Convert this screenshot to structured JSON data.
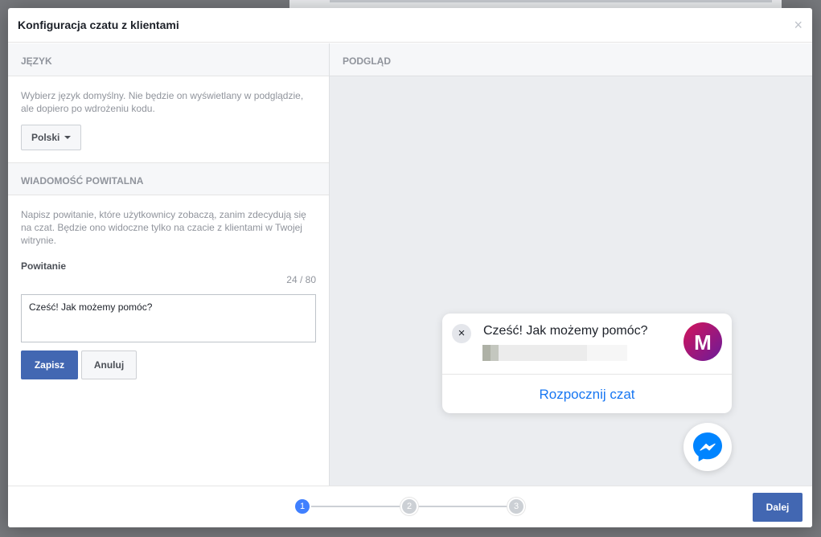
{
  "dialog": {
    "title": "Konfiguracja czatu z klientami",
    "close_glyph": "×"
  },
  "language_section": {
    "heading": "JĘZYK",
    "help": "Wybierz język domyślny. Nie będzie on wyświetlany w podglądzie, ale dopiero po wdrożeniu kodu.",
    "selected_language": "Polski"
  },
  "welcome_section": {
    "heading": "WIADOMOŚĆ POWITALNA",
    "help": "Napisz powitanie, które użytkownicy zobaczą, zanim zdecydują się na czat. Będzie ono widoczne tylko na czacie z klientami w Twojej witrynie.",
    "field_label": "Powitanie",
    "counter": "24 / 80",
    "greeting_value": "Cześć! Jak możemy pomóc?",
    "save_label": "Zapisz",
    "cancel_label": "Anuluj"
  },
  "preview": {
    "heading": "PODGLĄD",
    "greeting": "Cześć! Jak możemy pomóc?",
    "start_chat_label": "Rozpocznij czat",
    "close_glyph": "×",
    "avatar_letter": "M"
  },
  "footer": {
    "steps": [
      "1",
      "2",
      "3"
    ],
    "active_step": 1,
    "next_label": "Dalej"
  },
  "colors": {
    "primary": "#4267b2",
    "step_active": "#4080ff",
    "link": "#1877f2",
    "messenger": "#0084ff"
  },
  "icons": [
    "close-icon",
    "chevron-down-icon",
    "messenger-icon"
  ]
}
